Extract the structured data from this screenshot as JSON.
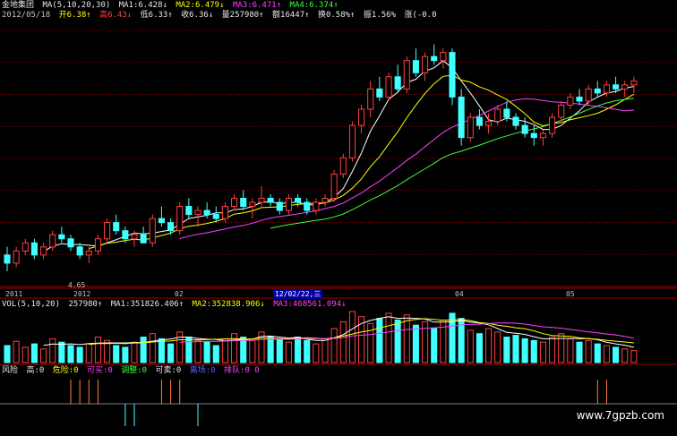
{
  "header": {
    "stock_name": "金地集团",
    "ma_label": "MA(5,10,20,30)",
    "ma1": "MA1:6.428↓",
    "ma2": "MA2:6.479↓",
    "ma3": "MA3:6.471↑",
    "ma4": "MA4:6.374↑",
    "date": "2012/05/18",
    "open": "开6.38↑",
    "high": "高6.43↓",
    "low": "低6.33↑",
    "close": "收6.36↓",
    "volume": "量257980↑",
    "amount": "额16447↑",
    "turnover": "换0.58%↑",
    "amplitude": "振1.56%",
    "change": "涨(-0.0"
  },
  "price_annotation": "4.65",
  "x_axis": {
    "y2011": "2011",
    "y2012": "2012",
    "m02": "02",
    "selected_date": "12/02/22,三",
    "m04": "04",
    "m05": "05"
  },
  "volume_panel": {
    "label": "VOL(5,10,20)",
    "current": "257980↑",
    "ma1": "MA1:351826.406↑",
    "ma2": "MA2:352838.906↓",
    "ma3": "MA3:468561.094↓"
  },
  "risk_panel": {
    "name": "风险",
    "high": "高:0",
    "danger": "危险:0",
    "buy": "可买:0",
    "adjust": "调整:0",
    "sell": "可卖:0",
    "out": "离场:0",
    "queue": "排队:0 0"
  },
  "watermark": "www.7gpzb.com",
  "colors": {
    "background": "#000000",
    "up": "#ff4040",
    "down": "#40ffff",
    "ma1": "#ffffff",
    "ma2": "#ffff00",
    "ma3": "#ff40ff",
    "ma4": "#40ff40",
    "grid": "#a00000"
  },
  "chart_data": {
    "type": "candlestick",
    "candles": [
      [
        4.85,
        4.95,
        4.65,
        4.75
      ],
      [
        4.75,
        4.95,
        4.7,
        4.9
      ],
      [
        4.9,
        5.05,
        4.85,
        5.0
      ],
      [
        5.0,
        5.05,
        4.8,
        4.85
      ],
      [
        4.85,
        5.0,
        4.8,
        4.95
      ],
      [
        4.95,
        5.15,
        4.9,
        5.1
      ],
      [
        5.1,
        5.2,
        5.0,
        5.05
      ],
      [
        5.05,
        5.1,
        4.9,
        4.95
      ],
      [
        4.95,
        5.0,
        4.8,
        4.85
      ],
      [
        4.85,
        4.95,
        4.75,
        4.9
      ],
      [
        4.9,
        5.1,
        4.85,
        5.05
      ],
      [
        5.05,
        5.3,
        5.0,
        5.25
      ],
      [
        5.25,
        5.35,
        5.1,
        5.15
      ],
      [
        5.15,
        5.2,
        5.0,
        5.05
      ],
      [
        5.05,
        5.15,
        4.95,
        5.1
      ],
      [
        5.1,
        5.2,
        5.0,
        5.0
      ],
      [
        5.0,
        5.35,
        4.95,
        5.3
      ],
      [
        5.3,
        5.45,
        5.2,
        5.25
      ],
      [
        5.25,
        5.3,
        5.1,
        5.15
      ],
      [
        5.15,
        5.5,
        5.1,
        5.45
      ],
      [
        5.45,
        5.55,
        5.3,
        5.35
      ],
      [
        5.35,
        5.45,
        5.2,
        5.4
      ],
      [
        5.4,
        5.5,
        5.3,
        5.35
      ],
      [
        5.35,
        5.45,
        5.25,
        5.3
      ],
      [
        5.3,
        5.5,
        5.25,
        5.45
      ],
      [
        5.45,
        5.6,
        5.4,
        5.55
      ],
      [
        5.55,
        5.65,
        5.4,
        5.45
      ],
      [
        5.45,
        5.55,
        5.3,
        5.5
      ],
      [
        5.5,
        5.7,
        5.45,
        5.55
      ],
      [
        5.55,
        5.6,
        5.45,
        5.5
      ],
      [
        5.5,
        5.55,
        5.35,
        5.4
      ],
      [
        5.4,
        5.6,
        5.35,
        5.55
      ],
      [
        5.55,
        5.6,
        5.45,
        5.5
      ],
      [
        5.5,
        5.55,
        5.35,
        5.4
      ],
      [
        5.4,
        5.55,
        5.35,
        5.5
      ],
      [
        5.5,
        5.6,
        5.45,
        5.55
      ],
      [
        5.55,
        5.9,
        5.5,
        5.85
      ],
      [
        5.85,
        6.1,
        5.8,
        6.05
      ],
      [
        6.05,
        6.5,
        6.0,
        6.45
      ],
      [
        6.45,
        6.7,
        6.35,
        6.65
      ],
      [
        6.65,
        7.0,
        6.55,
        6.9
      ],
      [
        6.9,
        7.05,
        6.75,
        6.8
      ],
      [
        6.8,
        7.1,
        6.75,
        7.05
      ],
      [
        7.05,
        7.2,
        6.85,
        6.9
      ],
      [
        6.9,
        7.3,
        6.85,
        7.25
      ],
      [
        7.25,
        7.4,
        7.05,
        7.1
      ],
      [
        7.1,
        7.35,
        7.0,
        7.3
      ],
      [
        7.3,
        7.45,
        7.2,
        7.25
      ],
      [
        7.25,
        7.4,
        7.15,
        7.35
      ],
      [
        7.35,
        7.4,
        6.7,
        6.8
      ],
      [
        6.8,
        6.9,
        6.2,
        6.3
      ],
      [
        6.3,
        6.6,
        6.25,
        6.55
      ],
      [
        6.55,
        6.65,
        6.4,
        6.45
      ],
      [
        6.45,
        6.6,
        6.35,
        6.5
      ],
      [
        6.5,
        6.7,
        6.45,
        6.65
      ],
      [
        6.65,
        6.75,
        6.5,
        6.55
      ],
      [
        6.55,
        6.6,
        6.4,
        6.45
      ],
      [
        6.45,
        6.55,
        6.3,
        6.35
      ],
      [
        6.35,
        6.45,
        6.2,
        6.3
      ],
      [
        6.3,
        6.4,
        6.2,
        6.35
      ],
      [
        6.35,
        6.6,
        6.3,
        6.55
      ],
      [
        6.55,
        6.75,
        6.5,
        6.7
      ],
      [
        6.7,
        6.85,
        6.65,
        6.8
      ],
      [
        6.8,
        6.9,
        6.7,
        6.75
      ],
      [
        6.75,
        6.95,
        6.7,
        6.9
      ],
      [
        6.9,
        7.0,
        6.8,
        6.85
      ],
      [
        6.85,
        7.0,
        6.8,
        6.95
      ],
      [
        6.95,
        7.05,
        6.85,
        6.9
      ],
      [
        6.9,
        7.0,
        6.8,
        6.95
      ],
      [
        6.95,
        7.05,
        6.85,
        7.0
      ]
    ],
    "volume": [
      20,
      25,
      18,
      22,
      16,
      28,
      24,
      20,
      18,
      22,
      30,
      26,
      20,
      18,
      24,
      30,
      34,
      28,
      22,
      36,
      30,
      26,
      24,
      20,
      28,
      34,
      30,
      26,
      36,
      30,
      28,
      24,
      30,
      26,
      22,
      28,
      40,
      48,
      60,
      54,
      46,
      52,
      58,
      50,
      56,
      44,
      48,
      40,
      50,
      58,
      52,
      38,
      34,
      40,
      36,
      30,
      32,
      28,
      26,
      24,
      30,
      34,
      28,
      24,
      26,
      22,
      20,
      18,
      16,
      14
    ],
    "risk_signal": [
      0,
      0,
      0,
      0,
      0,
      0,
      0,
      1,
      1,
      1,
      1,
      0,
      0,
      -1,
      -1,
      0,
      0,
      1,
      1,
      1,
      0,
      -1,
      0,
      0,
      0,
      0,
      0,
      0,
      0,
      0,
      0,
      0,
      0,
      0,
      0,
      0,
      0,
      0,
      0,
      0,
      0,
      0,
      0,
      0,
      0,
      0,
      0,
      0,
      0,
      0,
      0,
      0,
      0,
      0,
      0,
      0,
      0,
      0,
      0,
      0,
      0,
      0,
      0,
      0,
      0,
      1,
      1,
      0,
      0,
      0
    ]
  }
}
